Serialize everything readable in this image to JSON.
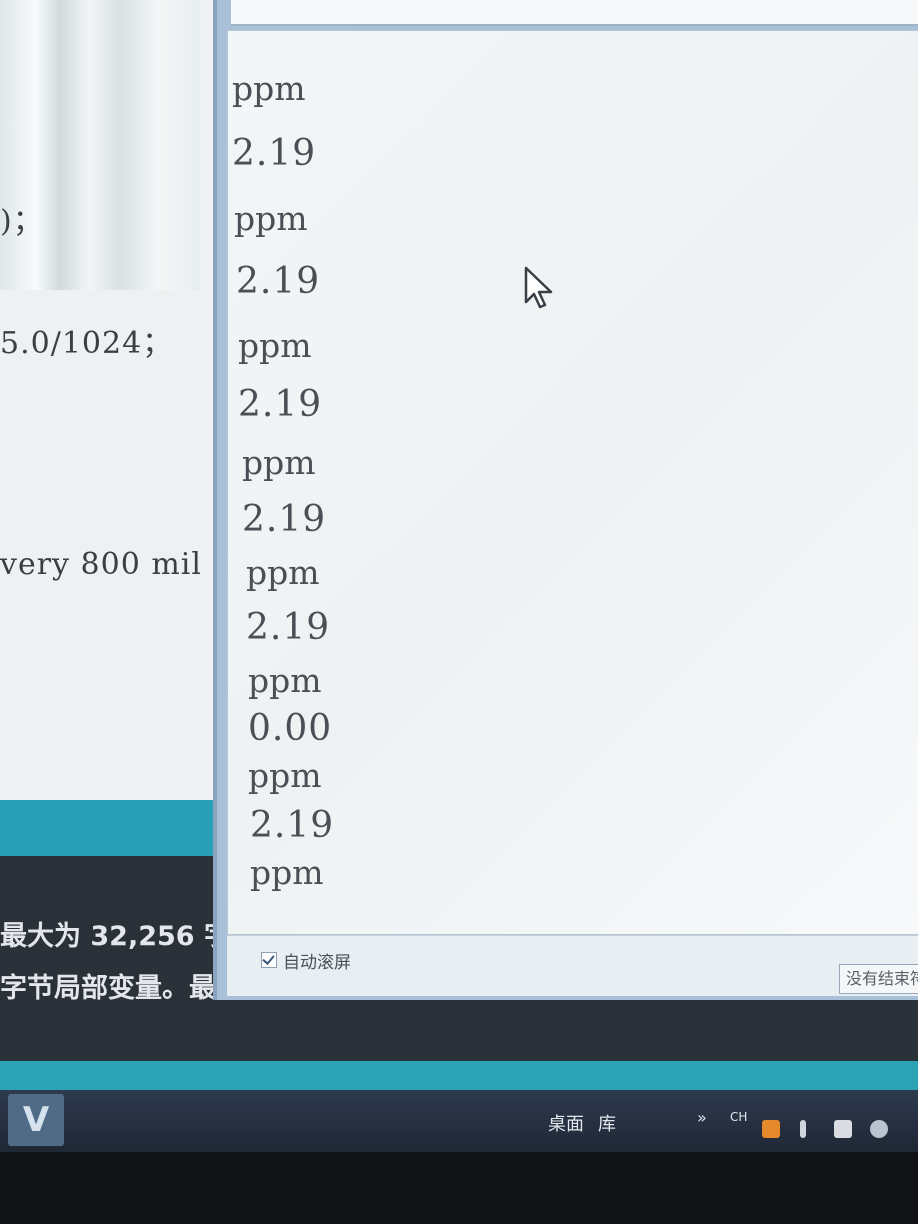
{
  "ide": {
    "code_lines": [
      ")；",
      "5.0/1024；",
      "very 800 mil"
    ],
    "console_lines": [
      "最大为 32,256 字",
      "字节局部变量。最"
    ]
  },
  "serial_monitor": {
    "output_lines": [
      {
        "kind": "unit",
        "text": "ppm"
      },
      {
        "kind": "value",
        "text": "2.19"
      },
      {
        "kind": "unit",
        "text": "ppm"
      },
      {
        "kind": "value",
        "text": "2.19"
      },
      {
        "kind": "unit",
        "text": "ppm"
      },
      {
        "kind": "value",
        "text": "2.19"
      },
      {
        "kind": "unit",
        "text": "ppm"
      },
      {
        "kind": "value",
        "text": "2.19"
      },
      {
        "kind": "unit",
        "text": "ppm"
      },
      {
        "kind": "value",
        "text": "2.19"
      },
      {
        "kind": "unit",
        "text": "ppm"
      },
      {
        "kind": "value",
        "text": "0.00"
      },
      {
        "kind": "unit",
        "text": "ppm"
      },
      {
        "kind": "value",
        "text": "2.19"
      },
      {
        "kind": "unit",
        "text": "ppm"
      }
    ],
    "autoscroll_label": "自动滚屏",
    "autoscroll_checked": true,
    "line_ending": "没有结束符"
  },
  "taskbar": {
    "desktop_label": "桌面",
    "library_label": "库",
    "overflow_chevron": "»",
    "ime_label": "CH"
  },
  "icons": {
    "cursor": "mouse-pointer-icon",
    "start": "start-button-icon"
  }
}
